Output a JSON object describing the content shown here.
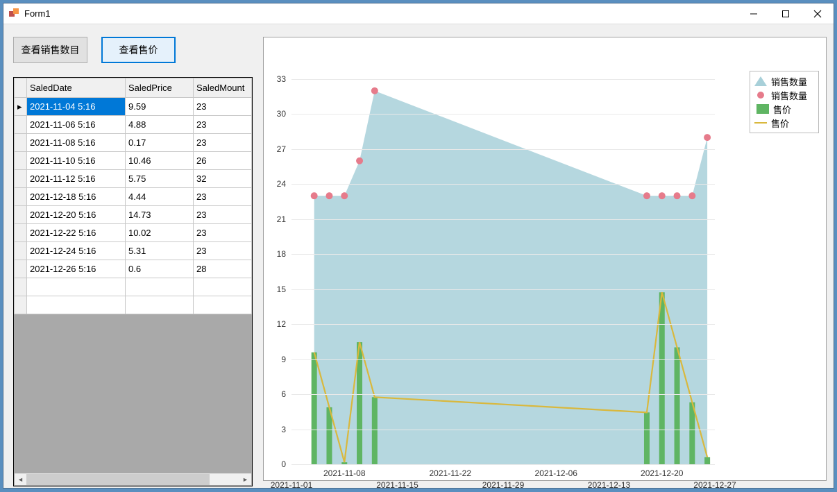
{
  "window": {
    "title": "Form1"
  },
  "toolbar": {
    "btn_view_count": "查看销售数目",
    "btn_view_price": "查看售价"
  },
  "grid": {
    "columns": [
      "SaledDate",
      "SaledPrice",
      "SaledMount"
    ],
    "rows": [
      {
        "date": "2021-11-04 5:16",
        "price": "9.59",
        "mount": "23"
      },
      {
        "date": "2021-11-06 5:16",
        "price": "4.88",
        "mount": "23"
      },
      {
        "date": "2021-11-08 5:16",
        "price": "0.17",
        "mount": "23"
      },
      {
        "date": "2021-11-10 5:16",
        "price": "10.46",
        "mount": "26"
      },
      {
        "date": "2021-11-12 5:16",
        "price": "5.75",
        "mount": "32"
      },
      {
        "date": "2021-12-18 5:16",
        "price": "4.44",
        "mount": "23"
      },
      {
        "date": "2021-12-20 5:16",
        "price": "14.73",
        "mount": "23"
      },
      {
        "date": "2021-12-22 5:16",
        "price": "10.02",
        "mount": "23"
      },
      {
        "date": "2021-12-24 5:16",
        "price": "5.31",
        "mount": "23"
      },
      {
        "date": "2021-12-26 5:16",
        "price": "0.6",
        "mount": "28"
      }
    ],
    "selected_row": 0,
    "selected_col": 0
  },
  "chart_data": {
    "type": "composite",
    "title": "",
    "xlabel": "",
    "ylabel": "",
    "ylim": [
      0,
      33
    ],
    "x_date_range": [
      "2021-11-01",
      "2021-12-27"
    ],
    "x_ticks_upper": [
      "2021-11-08",
      "2021-11-22",
      "2021-12-06",
      "2021-12-20"
    ],
    "x_ticks_lower": [
      "2021-11-01",
      "2021-11-15",
      "2021-11-29",
      "2021-12-13",
      "2021-12-27"
    ],
    "y_ticks": [
      0,
      3,
      6,
      9,
      12,
      15,
      18,
      21,
      24,
      27,
      30,
      33
    ],
    "series": [
      {
        "name": "销售数量",
        "render": "area",
        "color": "#a8d0d9",
        "x": [
          "2021-11-04",
          "2021-11-06",
          "2021-11-08",
          "2021-11-10",
          "2021-11-12",
          "2021-12-18",
          "2021-12-20",
          "2021-12-22",
          "2021-12-24",
          "2021-12-26"
        ],
        "values": [
          23,
          23,
          23,
          26,
          32,
          23,
          23,
          23,
          23,
          28
        ]
      },
      {
        "name": "销售数量",
        "render": "scatter",
        "color": "#e67b8b",
        "x": [
          "2021-11-04",
          "2021-11-06",
          "2021-11-08",
          "2021-11-10",
          "2021-11-12",
          "2021-12-18",
          "2021-12-20",
          "2021-12-22",
          "2021-12-24",
          "2021-12-26"
        ],
        "values": [
          23,
          23,
          23,
          26,
          32,
          23,
          23,
          23,
          23,
          28
        ]
      },
      {
        "name": "售价",
        "render": "bar",
        "color": "#5fb563",
        "x": [
          "2021-11-04",
          "2021-11-06",
          "2021-11-08",
          "2021-11-10",
          "2021-11-12",
          "2021-12-18",
          "2021-12-20",
          "2021-12-22",
          "2021-12-24",
          "2021-12-26"
        ],
        "values": [
          9.59,
          4.88,
          0.17,
          10.46,
          5.75,
          4.44,
          14.73,
          10.02,
          5.31,
          0.6
        ]
      },
      {
        "name": "售价",
        "render": "line",
        "color": "#d9b83d",
        "x": [
          "2021-11-04",
          "2021-11-06",
          "2021-11-08",
          "2021-11-10",
          "2021-11-12",
          "2021-12-18",
          "2021-12-20",
          "2021-12-22",
          "2021-12-24",
          "2021-12-26"
        ],
        "values": [
          9.59,
          4.88,
          0.17,
          10.46,
          5.75,
          4.44,
          14.73,
          10.02,
          5.31,
          0.6
        ]
      }
    ],
    "legend": [
      "销售数量",
      "销售数量",
      "售价",
      "售价"
    ]
  }
}
